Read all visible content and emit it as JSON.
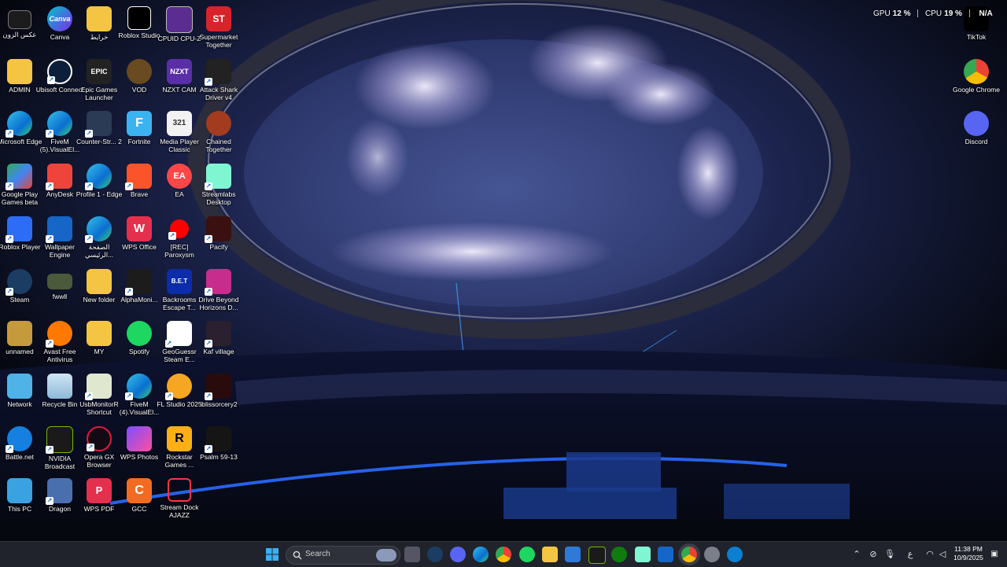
{
  "desktop": {
    "col1": [
      "عكس الزون",
      "ADMIN",
      "Microsoft Edge",
      "Google Play Games beta",
      "Roblox Player",
      "Steam",
      "unnamed",
      "Network",
      "Battle.net",
      "This PC"
    ],
    "col2": [
      "Canva",
      "Ubisoft Connect",
      "FiveM (5).VisualEl...",
      "AnyDesk",
      "Wallpaper Engine",
      "fwwll",
      "Avast Free Antivirus",
      "Recycle Bin",
      "NVIDIA Broadcast",
      "Dragon"
    ],
    "col3": [
      "خرايط",
      "Epic Games Launcher",
      "Counter-Str... 2",
      "Profile 1 - Edge",
      "الصفحة الرئيسي...",
      "New folder",
      "MY",
      "UsbMonitorR Shortcut",
      "Opera GX Browser",
      "WPS PDF"
    ],
    "col4": [
      "Roblox Studio",
      "VOD",
      "Fortnite",
      "Brave",
      "WPS Office",
      "AlphaMoni...",
      "Spotify",
      "FiveM (4).VisualEl...",
      "WPS Photos",
      "GCC"
    ],
    "col5": [
      "CPUID CPU-Z",
      "NZXT CAM",
      "Media Player Classic",
      "EA",
      "[REC] Paroxysm",
      "Backrooms Escape T...",
      "GeoGuessr Steam E...",
      "FL Studio 2025",
      "Rockstar Games ...",
      "Stream Dock AJAZZ"
    ],
    "col6": [
      "Supermarket Together",
      "Attack Shark Driver v4",
      "Chained Together",
      "Streamlabs Desktop",
      "Pacify",
      "Drive Beyond Horizons D...",
      "Kaf village",
      "iblissorcery2",
      "Psalm 59-13"
    ],
    "right": [
      "TikTok",
      "Google Chrome",
      "Discord"
    ]
  },
  "icon_text": {
    "canva": "Canva",
    "epic": "EPIC",
    "nzxt": "NZXT",
    "st": "ST",
    "ea": "EA",
    "wps": "W",
    "bet": "B.E.T",
    "fortnite": "F",
    "r": "R",
    "gcc": "C",
    "pdf": "P",
    "mpc": "321"
  },
  "overlay": {
    "gpu_label": "GPU",
    "gpu_value": "12 %",
    "cpu_label": "CPU",
    "cpu_value": "19 %",
    "na": "N/A"
  },
  "taskbar": {
    "search_placeholder": "Search",
    "language": "ع",
    "time": "11:38 PM",
    "date": "10/9/2025"
  },
  "colors": {
    "accent": "#0078d4",
    "taskbar_bg": "#20232b"
  }
}
